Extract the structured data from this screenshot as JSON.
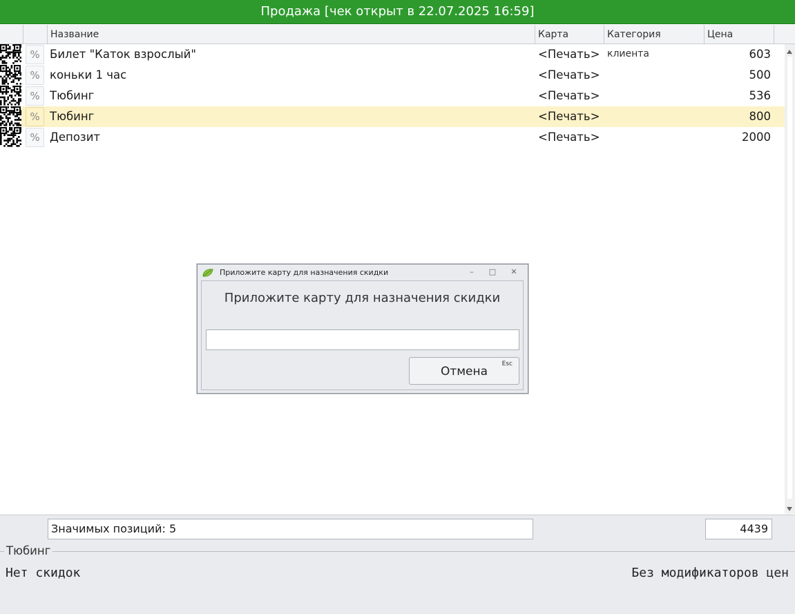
{
  "window": {
    "title": "Продажа [чек открыт в 22.07.2025 16:59]"
  },
  "table": {
    "columns": {
      "name": "Название",
      "card": "Карта",
      "category": "Категория клиента",
      "price": "Цена"
    },
    "discount_symbol": "%",
    "rows": [
      {
        "name": "Билет \"Каток взрослый\"",
        "card": "<Печать>",
        "category": "",
        "price": "603",
        "selected": false
      },
      {
        "name": "коньки 1 час",
        "card": "<Печать>",
        "category": "",
        "price": "500",
        "selected": false
      },
      {
        "name": "Тюбинг",
        "card": "<Печать>",
        "category": "",
        "price": "536",
        "selected": false
      },
      {
        "name": "Тюбинг",
        "card": "<Печать>",
        "category": "",
        "price": "800",
        "selected": true
      },
      {
        "name": "Депозит",
        "card": "<Печать>",
        "category": "",
        "price": "2000",
        "selected": false
      }
    ]
  },
  "footer": {
    "count_text": "Значимых позиций: 5",
    "total": "4439",
    "group_title": "Тюбинг",
    "discounts": "Нет скидок",
    "modifiers": "Без модификаторов цен"
  },
  "dialog": {
    "title": "Приложите карту для назначения скидки",
    "message": "Приложите карту для назначения скидки",
    "input_value": "",
    "cancel_label": "Отмена",
    "cancel_hotkey": "Esc",
    "icon": "leaf-icon"
  },
  "colors": {
    "titlebar": "#2e9a2e",
    "selected_row": "#fdf3c8"
  }
}
